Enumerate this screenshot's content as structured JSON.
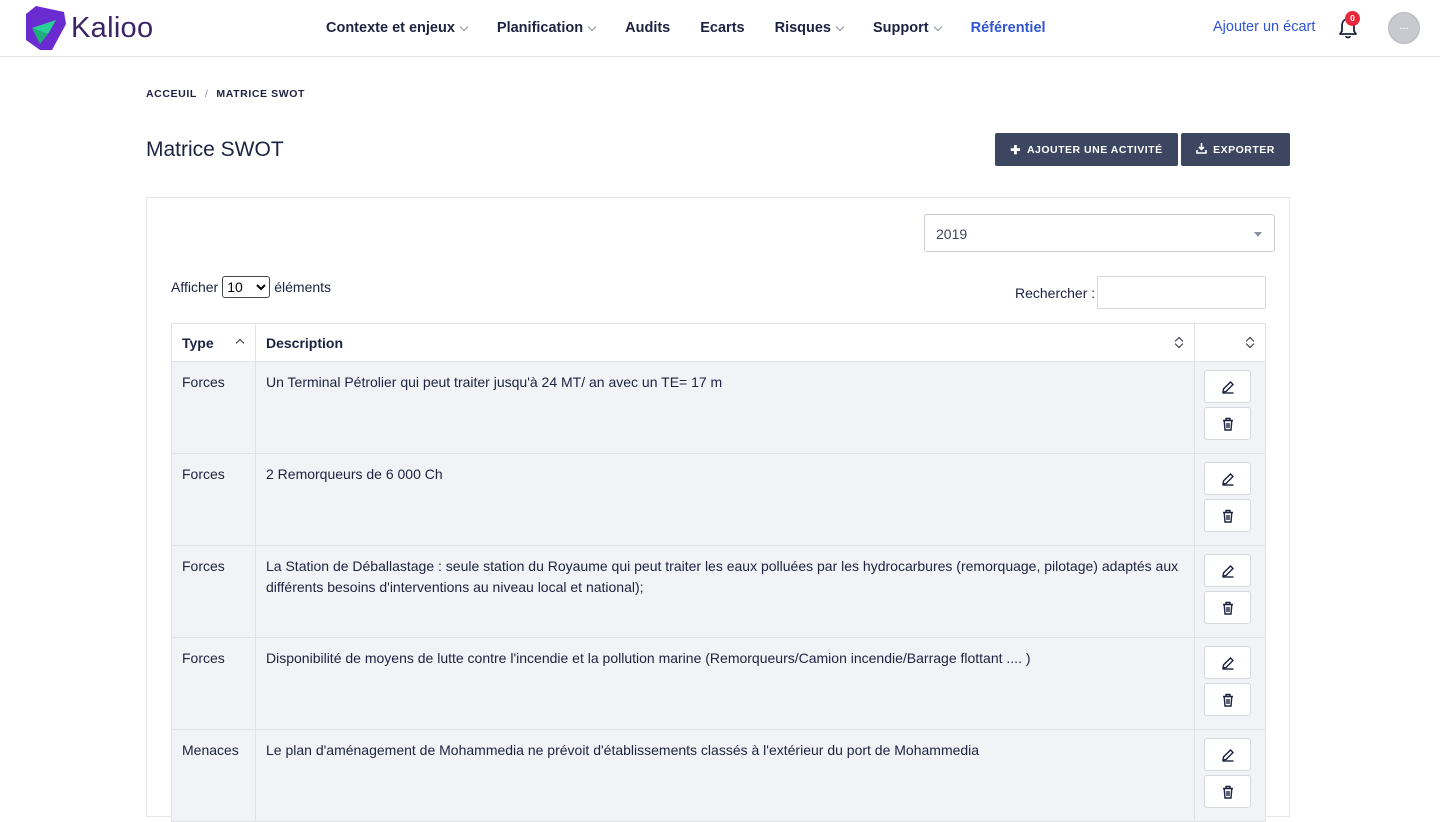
{
  "app": {
    "logo_text": "Kalioo",
    "brand_colors": {
      "purple": "#6a2bd1",
      "green": "#2ad196",
      "accent_blue": "#2f55d4"
    }
  },
  "navbar": {
    "items": [
      {
        "label": "Contexte et enjeux",
        "dropdown": true
      },
      {
        "label": "Planification",
        "dropdown": true
      },
      {
        "label": "Audits",
        "dropdown": false
      },
      {
        "label": "Ecarts",
        "dropdown": false
      },
      {
        "label": "Risques",
        "dropdown": true
      },
      {
        "label": "Support",
        "dropdown": true
      },
      {
        "label": "Référentiel",
        "dropdown": false,
        "active": true
      }
    ],
    "add_ecart_label": "Ajouter un écart",
    "notification_count": "0",
    "avatar_text": "---"
  },
  "breadcrumb": {
    "home": "ACCEUIL",
    "separator": "/",
    "current": "MATRICE SWOT"
  },
  "page": {
    "title": "Matrice SWOT",
    "add_button_label": "AJOUTER UNE ACTIVITÉ",
    "export_button_label": "EXPORTER"
  },
  "filters": {
    "year_selected": "2019",
    "length_prefix": "Afficher",
    "length_value": "10",
    "length_suffix": "éléments",
    "search_label": "Rechercher :"
  },
  "table": {
    "columns": [
      "Type",
      "Description",
      ""
    ],
    "rows": [
      {
        "type": "Forces",
        "description": "Un Terminal Pétrolier qui peut traiter jusqu'à 24 MT/ an avec un TE= 17 m"
      },
      {
        "type": "Forces",
        "description": "2 Remorqueurs de 6 000 Ch"
      },
      {
        "type": "Forces",
        "description": "La Station de Déballastage : seule station du Royaume qui peut traiter les eaux polluées par les hydrocarbures (remorquage, pilotage) adaptés aux différents besoins d'interventions au niveau local et national);"
      },
      {
        "type": "Forces",
        "description": "Disponibilité de moyens de lutte contre l'incendie et la pollution marine (Remorqueurs/Camion incendie/Barrage flottant .... )"
      },
      {
        "type": "Menaces",
        "description": "Le plan d'aménagement de Mohammedia ne prévoit d'établissements classés à l'extérieur du port de Mohammedia"
      }
    ]
  }
}
